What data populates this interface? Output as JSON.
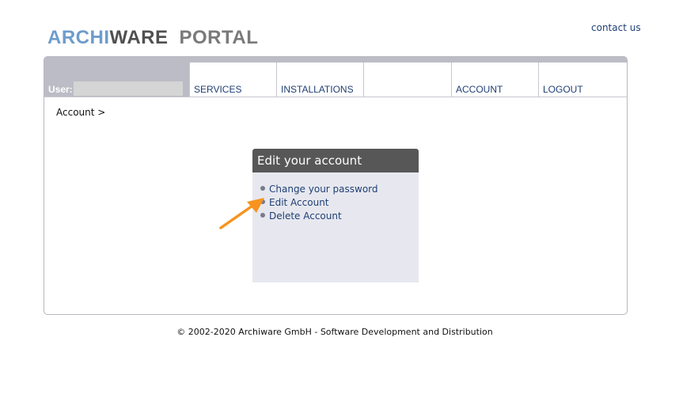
{
  "header": {
    "logo_archi": "ARCHI",
    "logo_ware": "WARE",
    "logo_portal": "PORTAL",
    "contact": "contact us"
  },
  "nav": {
    "user_label": "User:",
    "user_value": "",
    "tabs": [
      "SERVICES",
      "INSTALLATIONS",
      "",
      "ACCOUNT",
      "LOGOUT"
    ]
  },
  "breadcrumb": "Account >",
  "edit_box": {
    "title": "Edit your account",
    "items": [
      "Change your password",
      "Edit Account",
      "Delete Account"
    ]
  },
  "annotation": {
    "arrow_color": "#f7931e"
  },
  "footer": "© 2002-2020 Archiware GmbH - Software Development and Distribution"
}
